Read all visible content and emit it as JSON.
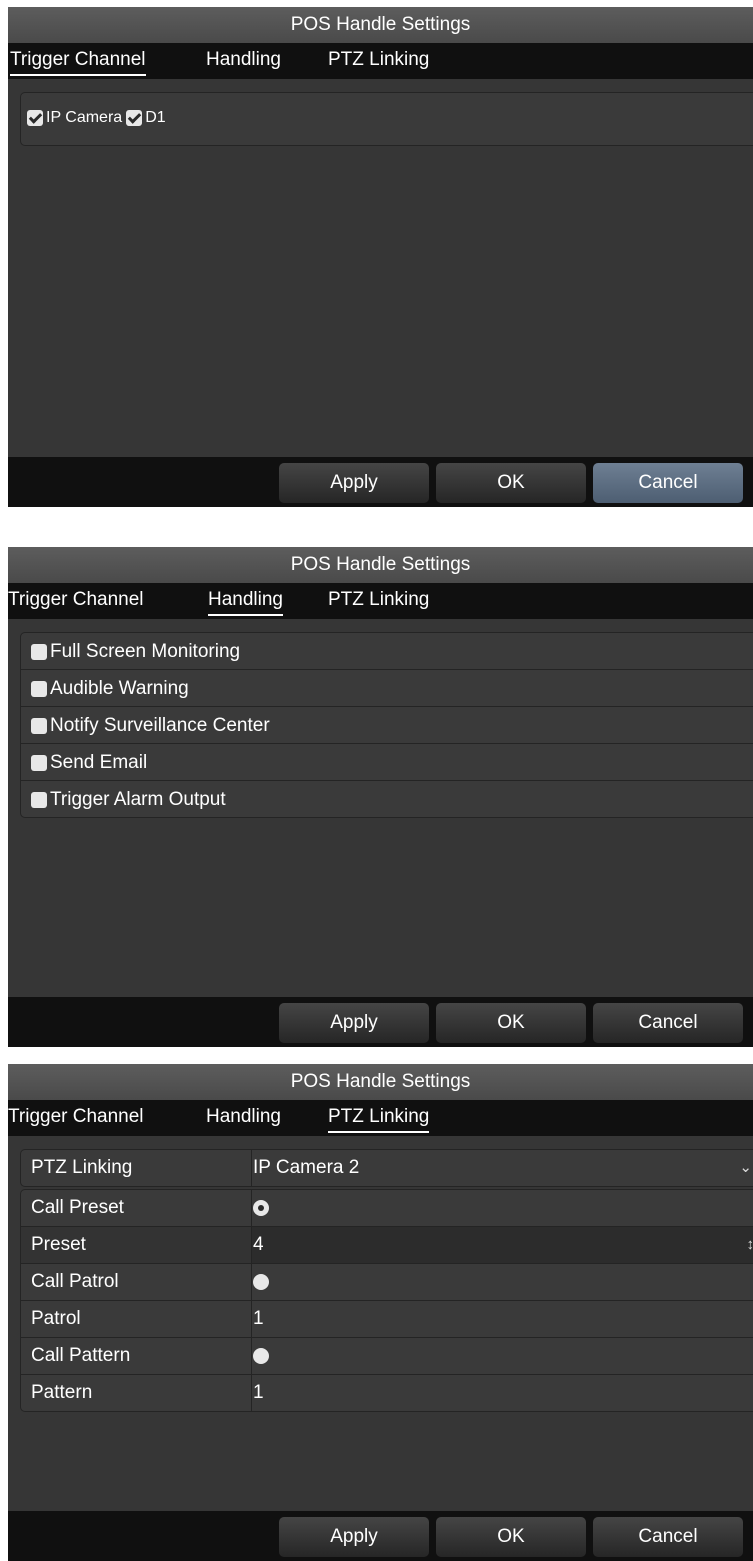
{
  "title": "POS Handle Settings",
  "tabs": [
    "Trigger Channel",
    "Handling",
    "PTZ Linking"
  ],
  "buttons": {
    "apply": "Apply",
    "ok": "OK",
    "cancel": "Cancel"
  },
  "trigger_channel": {
    "channels": [
      {
        "label": "IP Camera",
        "checked": true
      },
      {
        "label": "D1",
        "checked": true
      }
    ]
  },
  "handling": {
    "options": [
      {
        "label": "Full Screen Monitoring",
        "checked": false
      },
      {
        "label": "Audible Warning",
        "checked": false
      },
      {
        "label": "Notify Surveillance Center",
        "checked": false
      },
      {
        "label": "Send Email",
        "checked": false
      },
      {
        "label": "Trigger Alarm Output",
        "checked": false
      }
    ]
  },
  "ptz": {
    "rows": [
      {
        "label": "PTZ Linking",
        "value": "IP Camera 2"
      },
      {
        "label": "Call Preset",
        "value": ""
      },
      {
        "label": "Preset",
        "value": "4"
      },
      {
        "label": "Call Patrol",
        "value": ""
      },
      {
        "label": "Patrol",
        "value": "1"
      },
      {
        "label": "Call Pattern",
        "value": ""
      },
      {
        "label": "Pattern",
        "value": "1"
      }
    ],
    "call_preset_selected": true,
    "call_patrol_selected": false,
    "call_pattern_selected": false
  },
  "colors": {
    "panel": "#363636",
    "titlebar": "#4a4a4a",
    "tabbar": "#101010",
    "cancel_highlight": "#5d6e82"
  }
}
